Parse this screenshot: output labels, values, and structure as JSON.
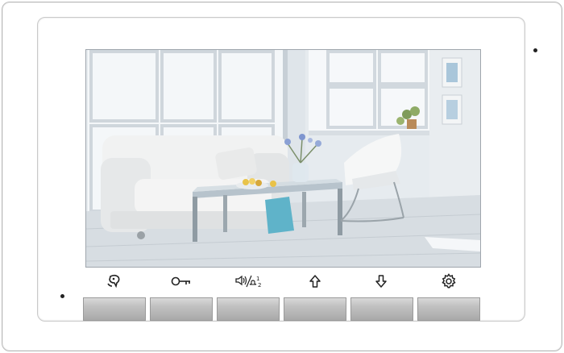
{
  "device": {
    "name": "video-door-intercom-monitor",
    "accent_color": "#c3c3c3",
    "frame_color": "#ffffff"
  },
  "screen": {
    "content": "living-room-camera-view"
  },
  "controls": [
    {
      "id": "talk",
      "icon": "talk-icon"
    },
    {
      "id": "unlock",
      "icon": "key-icon"
    },
    {
      "id": "volume",
      "icon": "volume-ring-icon",
      "text": "1 2"
    },
    {
      "id": "up",
      "icon": "arrow-up-icon"
    },
    {
      "id": "down",
      "icon": "arrow-down-icon"
    },
    {
      "id": "settings",
      "icon": "gear-icon"
    }
  ]
}
